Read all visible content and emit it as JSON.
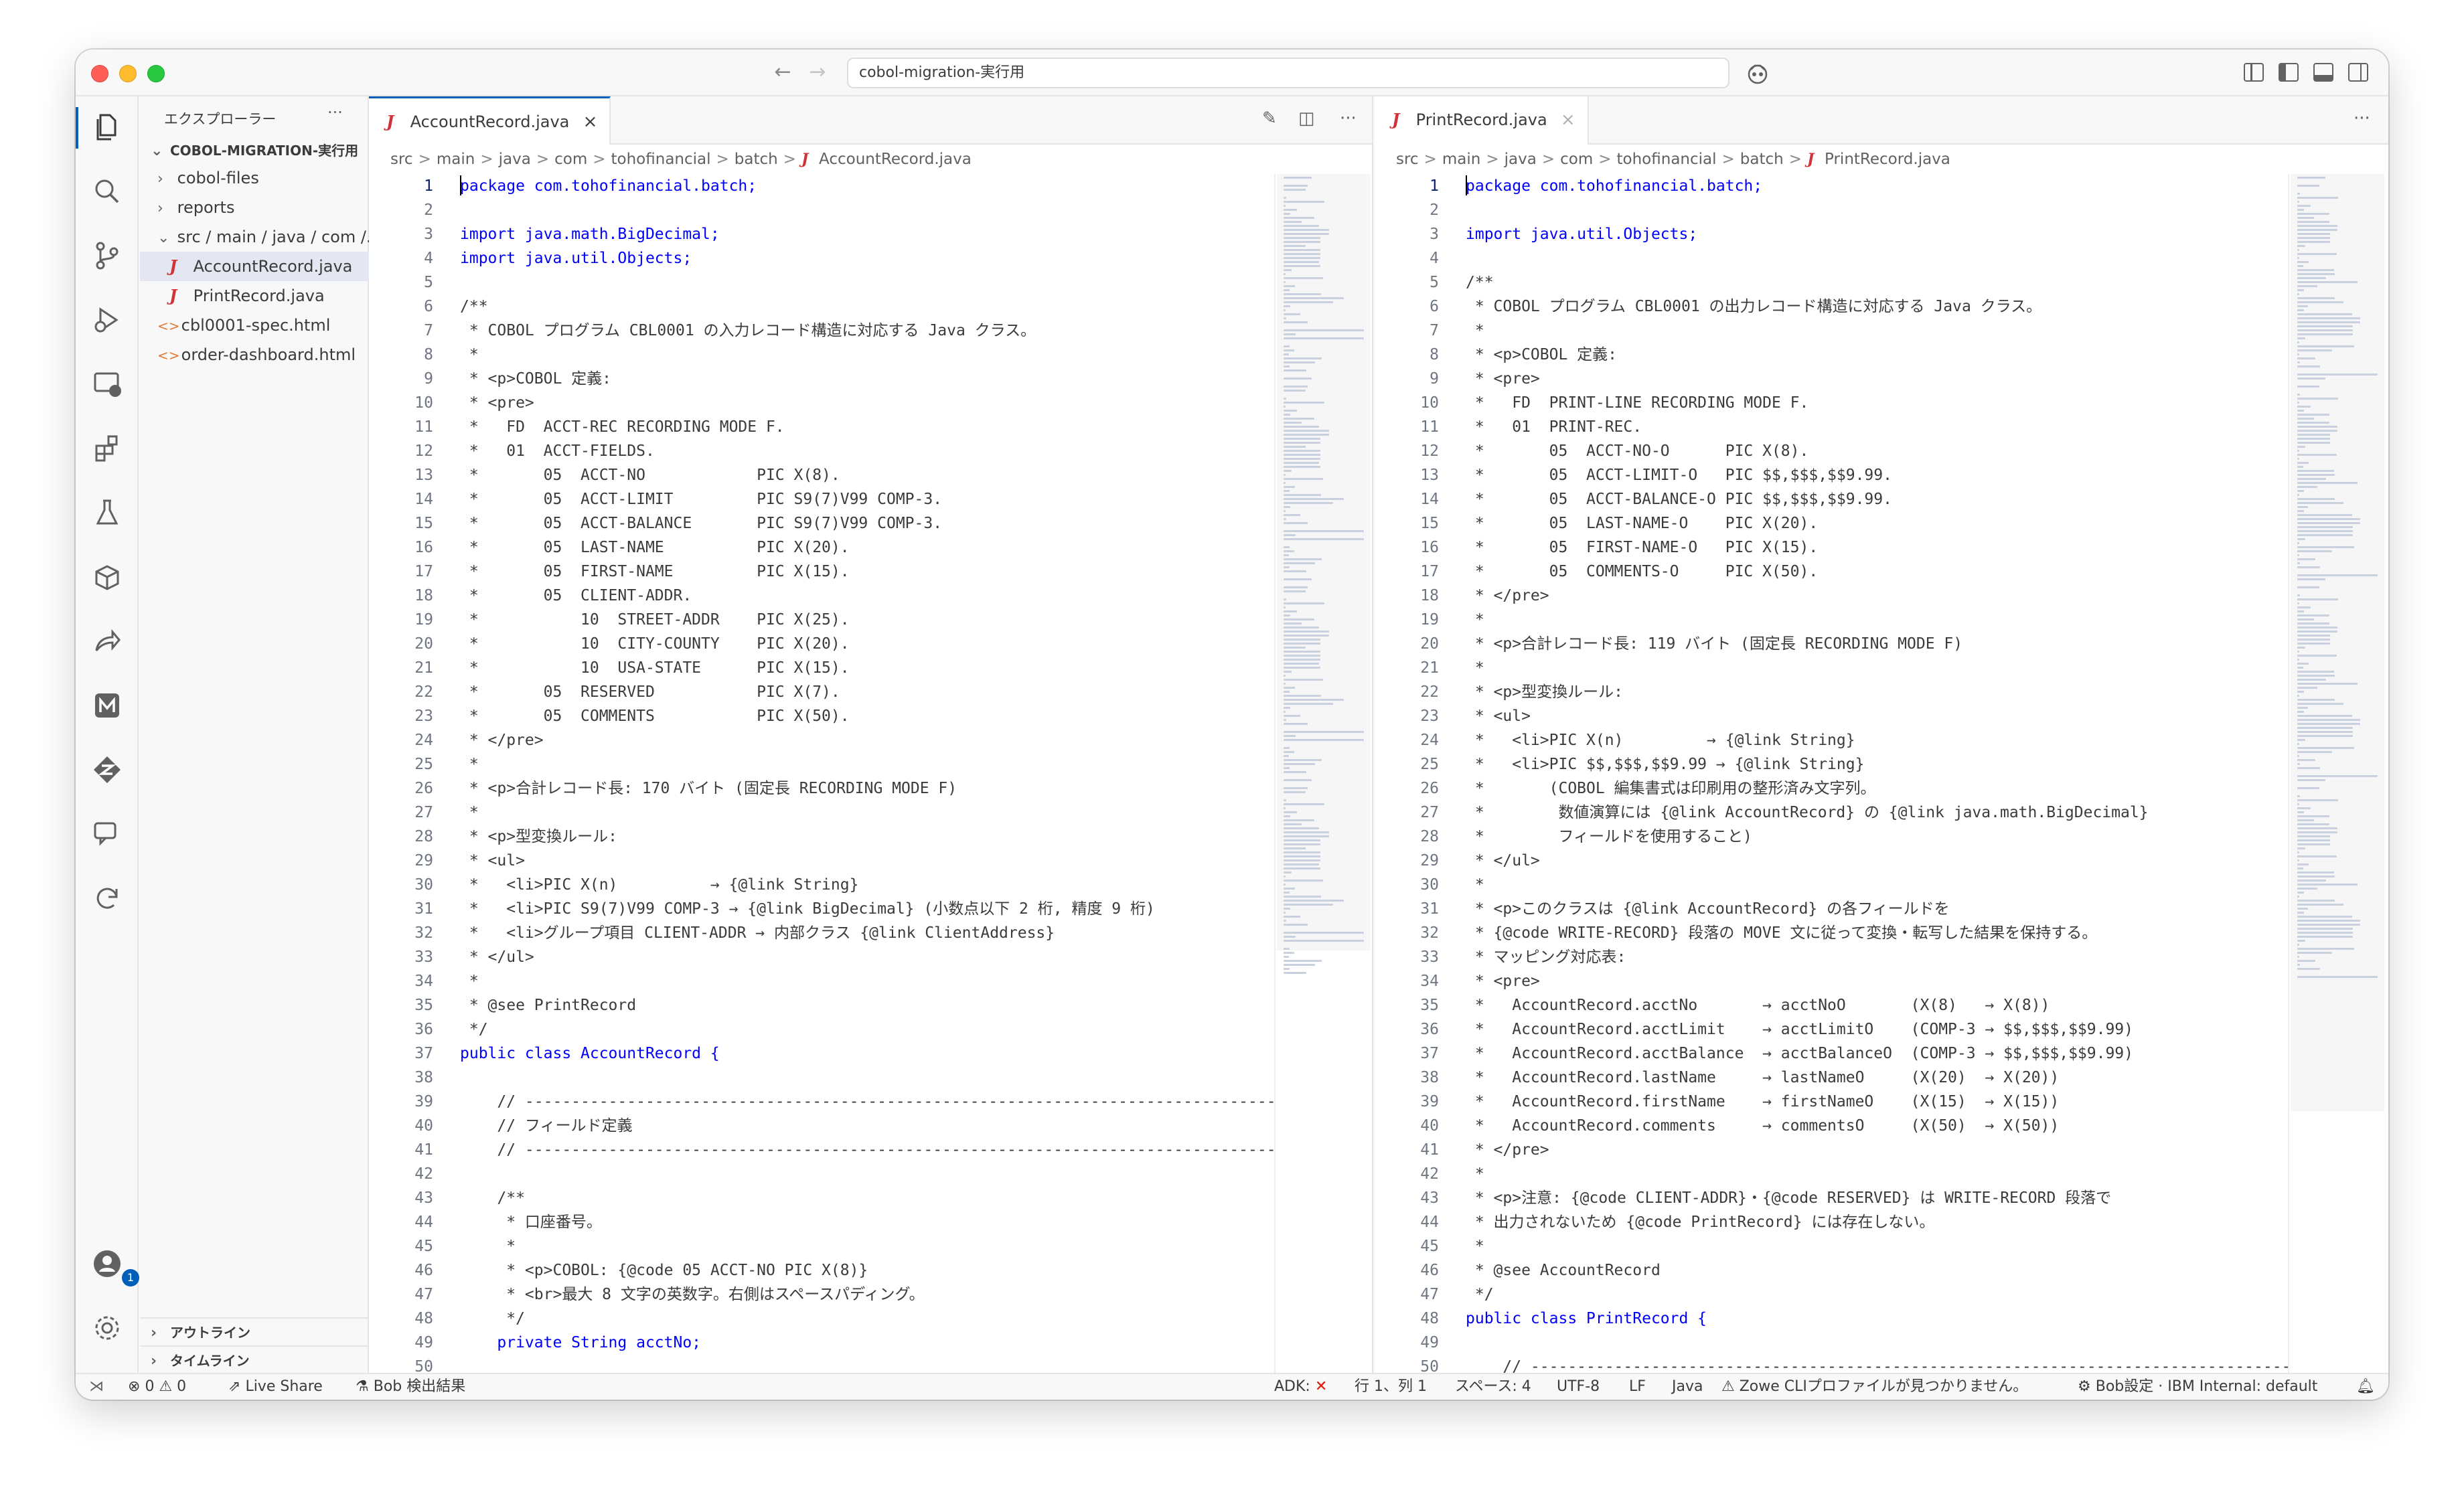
{
  "window": {
    "address": "cobol-migration-実行用"
  },
  "explorer": {
    "title": "エクスプローラー",
    "more": "···",
    "root": "COBOL-MIGRATION-実行用",
    "items": [
      {
        "label": "cobol-files",
        "type": "folder",
        "chev": "›"
      },
      {
        "label": "reports",
        "type": "folder",
        "chev": "›"
      },
      {
        "label": "src / main / java / com /...",
        "type": "folder",
        "chev": "⌄"
      },
      {
        "label": "AccountRecord.java",
        "type": "java"
      },
      {
        "label": "PrintRecord.java",
        "type": "java"
      },
      {
        "label": "cbl0001-spec.html",
        "type": "html"
      },
      {
        "label": "order-dashboard.html",
        "type": "html"
      }
    ],
    "outline": "アウトライン",
    "timeline": "タイムライン",
    "account_badge": "1"
  },
  "left_editor": {
    "tab": "AccountRecord.java",
    "breadcrumb": [
      "src",
      "main",
      "java",
      "com",
      "tohofinancial",
      "batch",
      "AccountRecord.java"
    ],
    "lines": [
      "package com.tohofinancial.batch;",
      "",
      "import java.math.BigDecimal;",
      "import java.util.Objects;",
      "",
      "/**",
      " * COBOL プログラム CBL0001 の入力レコード構造に対応する Java クラス。",
      " *",
      " * <p>COBOL 定義:",
      " * <pre>",
      " *   FD  ACCT-REC RECORDING MODE F.",
      " *   01  ACCT-FIELDS.",
      " *       05  ACCT-NO            PIC X(8).",
      " *       05  ACCT-LIMIT         PIC S9(7)V99 COMP-3.",
      " *       05  ACCT-BALANCE       PIC S9(7)V99 COMP-3.",
      " *       05  LAST-NAME          PIC X(20).",
      " *       05  FIRST-NAME         PIC X(15).",
      " *       05  CLIENT-ADDR.",
      " *           10  STREET-ADDR    PIC X(25).",
      " *           10  CITY-COUNTY    PIC X(20).",
      " *           10  USA-STATE      PIC X(15).",
      " *       05  RESERVED           PIC X(7).",
      " *       05  COMMENTS           PIC X(50).",
      " * </pre>",
      " *",
      " * <p>合計レコード長: 170 バイト (固定長 RECORDING MODE F)",
      " *",
      " * <p>型変換ルール:",
      " * <ul>",
      " *   <li>PIC X(n)          → {@link String}",
      " *   <li>PIC S9(7)V99 COMP-3 → {@link BigDecimal} (小数点以下 2 桁, 精度 9 桁)",
      " *   <li>グループ項目 CLIENT-ADDR → 内部クラス {@link ClientAddress}",
      " * </ul>",
      " *",
      " * @see PrintRecord",
      " */",
      "public class AccountRecord {",
      "",
      "    // ------------------------------------------------------------------------------------------",
      "    // フィールド定義",
      "    // ------------------------------------------------------------------------------------------",
      "",
      "    /**",
      "     * 口座番号。",
      "     *",
      "     * <p>COBOL: {@code 05 ACCT-NO PIC X(8)}",
      "     * <br>最大 8 文字の英数字。右側はスペースパディング。",
      "     */",
      "    private String acctNo;",
      ""
    ]
  },
  "right_editor": {
    "tab": "PrintRecord.java",
    "breadcrumb": [
      "src",
      "main",
      "java",
      "com",
      "tohofinancial",
      "batch",
      "PrintRecord.java"
    ],
    "lines": [
      "package com.tohofinancial.batch;",
      "",
      "import java.util.Objects;",
      "",
      "/**",
      " * COBOL プログラム CBL0001 の出力レコード構造に対応する Java クラス。",
      " *",
      " * <p>COBOL 定義:",
      " * <pre>",
      " *   FD  PRINT-LINE RECORDING MODE F.",
      " *   01  PRINT-REC.",
      " *       05  ACCT-NO-O      PIC X(8).",
      " *       05  ACCT-LIMIT-O   PIC $$,$$$,$$9.99.",
      " *       05  ACCT-BALANCE-O PIC $$,$$$,$$9.99.",
      " *       05  LAST-NAME-O    PIC X(20).",
      " *       05  FIRST-NAME-O   PIC X(15).",
      " *       05  COMMENTS-O     PIC X(50).",
      " * </pre>",
      " *",
      " * <p>合計レコード長: 119 バイト (固定長 RECORDING MODE F)",
      " *",
      " * <p>型変換ルール:",
      " * <ul>",
      " *   <li>PIC X(n)         → {@link String}",
      " *   <li>PIC $$,$$$,$$9.99 → {@link String}",
      " *       (COBOL 編集書式は印刷用の整形済み文字列。",
      " *        数値演算には {@link AccountRecord} の {@link java.math.BigDecimal}",
      " *        フィールドを使用すること)",
      " * </ul>",
      " *",
      " * <p>このクラスは {@link AccountRecord} の各フィールドを",
      " * {@code WRITE-RECORD} 段落の MOVE 文に従って変換・転写した結果を保持する。",
      " * マッピング対応表:",
      " * <pre>",
      " *   AccountRecord.acctNo       → acctNoO       (X(8)   → X(8))",
      " *   AccountRecord.acctLimit    → acctLimitO    (COMP-3 → $$,$$$,$$9.99)",
      " *   AccountRecord.acctBalance  → acctBalanceO  (COMP-3 → $$,$$$,$$9.99)",
      " *   AccountRecord.lastName     → lastNameO     (X(20)  → X(20))",
      " *   AccountRecord.firstName    → firstNameO    (X(15)  → X(15))",
      " *   AccountRecord.comments     → commentsO     (X(50)  → X(50))",
      " * </pre>",
      " *",
      " * <p>注意: {@code CLIENT-ADDR}・{@code RESERVED} は WRITE-RECORD 段落で",
      " * 出力されないため {@code PrintRecord} には存在しない。",
      " *",
      " * @see AccountRecord",
      " */",
      "public class PrintRecord {",
      "",
      "    // -------------------------------------------------------------------------------------------"
    ]
  },
  "statusbar": {
    "errors": "0",
    "warnings": "0",
    "live_share": "Live Share",
    "bob": "Bob 検出結果",
    "adk": "ADK:",
    "position": "行 1、列 1",
    "spaces": "スペース: 4",
    "encoding": "UTF-8",
    "eol": "LF",
    "language": "Java",
    "zowe": "Zowe CLIプロファイルが見つかりません。",
    "bob_settings": "Bob設定 · IBM Internal: default"
  },
  "colors": {
    "accent": "#005fb8",
    "keyword": "#0000ff",
    "java_icon": "#d13438",
    "html_icon": "#e37933"
  }
}
